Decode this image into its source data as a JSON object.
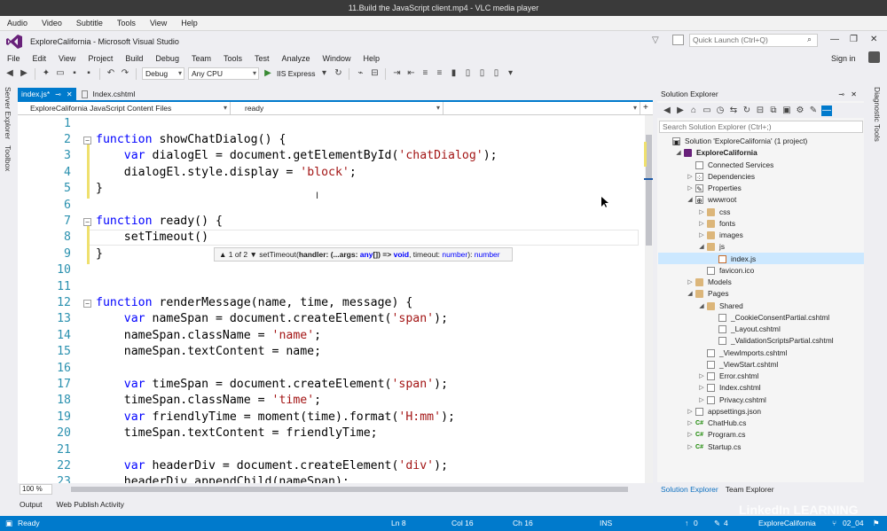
{
  "vlc": {
    "title": "11.Build the JavaScript client.mp4 - VLC media player",
    "menu": [
      "Audio",
      "Video",
      "Subtitle",
      "Tools",
      "View",
      "Help"
    ]
  },
  "vs": {
    "title": "ExploreCalifornia - Microsoft Visual Studio",
    "quick_launch_placeholder": "Quick Launch (Ctrl+Q)",
    "menu": [
      "File",
      "Edit",
      "View",
      "Project",
      "Build",
      "Debug",
      "Team",
      "Tools",
      "Test",
      "Analyze",
      "Window",
      "Help"
    ],
    "sign_in": "Sign in",
    "toolbar": {
      "config": "Debug",
      "platform": "Any CPU",
      "run_label": "IIS Express"
    }
  },
  "left_strip": [
    "Server Explorer",
    "Toolbox"
  ],
  "right_strip": [
    "Diagnostic Tools"
  ],
  "tabs": [
    {
      "label": "index.js*",
      "active": true
    },
    {
      "label": "Index.cshtml",
      "active": false
    }
  ],
  "nav_bar": {
    "project": "ExploreCalifornia JavaScript Content Files",
    "member": "ready",
    "third": ""
  },
  "code_lines": [
    {
      "n": "1",
      "t": ""
    },
    {
      "n": "2",
      "t": "function showChatDialog() {"
    },
    {
      "n": "3",
      "t": "    var dialogEl = document.getElementById('chatDialog');"
    },
    {
      "n": "4",
      "t": "    dialogEl.style.display = 'block';"
    },
    {
      "n": "5",
      "t": "}"
    },
    {
      "n": "6",
      "t": ""
    },
    {
      "n": "7",
      "t": "function ready() {"
    },
    {
      "n": "8",
      "t": "    setTimeout()"
    },
    {
      "n": "9",
      "t": "}"
    },
    {
      "n": "10",
      "t": ""
    },
    {
      "n": "11",
      "t": ""
    },
    {
      "n": "12",
      "t": "function renderMessage(name, time, message) {"
    },
    {
      "n": "13",
      "t": "    var nameSpan = document.createElement('span');"
    },
    {
      "n": "14",
      "t": "    nameSpan.className = 'name';"
    },
    {
      "n": "15",
      "t": "    nameSpan.textContent = name;"
    },
    {
      "n": "16",
      "t": ""
    },
    {
      "n": "17",
      "t": "    var timeSpan = document.createElement('span');"
    },
    {
      "n": "18",
      "t": "    timeSpan.className = 'time';"
    },
    {
      "n": "19",
      "t": "    var friendlyTime = moment(time).format('H:mm');"
    },
    {
      "n": "20",
      "t": "    timeSpan.textContent = friendlyTime;"
    },
    {
      "n": "21",
      "t": ""
    },
    {
      "n": "22",
      "t": "    var headerDiv = document.createElement('div');"
    },
    {
      "n": "23",
      "t": "    headerDiv.appendChild(nameSpan);"
    }
  ],
  "tooltip": {
    "counter": "1 of 2",
    "signature_prefix": "setTimeout(",
    "p1": "handler: (...args: ",
    "t1": "any",
    "p2": "[]) => ",
    "t2": "void",
    "p3": ", timeout: ",
    "t3": "number",
    "p4": "): ",
    "t4": "number"
  },
  "zoom": "100 %",
  "bottom_tabs": [
    "Output",
    "Web Publish Activity"
  ],
  "status": {
    "ready": "Ready",
    "ln": "Ln 8",
    "col": "Col 16",
    "ch": "Ch 16",
    "ins": "INS",
    "up": "0",
    "pencil": "4",
    "project": "ExploreCalifornia",
    "branch": "02_04"
  },
  "solution_explorer": {
    "title": "Solution Explorer",
    "search_placeholder": "Search Solution Explorer (Ctrl+;)",
    "items": [
      {
        "label": "Solution 'ExploreCalifornia' (1 project)",
        "icon": "solution",
        "tri": "",
        "depth": 0
      },
      {
        "label": "ExploreCalifornia",
        "icon": "project",
        "tri": "◢",
        "depth": 1,
        "bold": true
      },
      {
        "label": "Connected Services",
        "icon": "services",
        "tri": "",
        "depth": 2
      },
      {
        "label": "Dependencies",
        "icon": "deps",
        "tri": "▷",
        "depth": 2
      },
      {
        "label": "Properties",
        "icon": "wrench",
        "tri": "▷",
        "depth": 2
      },
      {
        "label": "wwwroot",
        "icon": "globe",
        "tri": "◢",
        "depth": 2
      },
      {
        "label": "css",
        "icon": "folder",
        "tri": "▷",
        "depth": 3
      },
      {
        "label": "fonts",
        "icon": "folder",
        "tri": "▷",
        "depth": 3
      },
      {
        "label": "images",
        "icon": "folder",
        "tri": "▷",
        "depth": 3
      },
      {
        "label": "js",
        "icon": "folder-open",
        "tri": "◢",
        "depth": 3
      },
      {
        "label": "index.js",
        "icon": "js",
        "tri": "",
        "depth": 4
      },
      {
        "label": "favicon.ico",
        "icon": "file",
        "tri": "",
        "depth": 3
      },
      {
        "label": "Models",
        "icon": "folder",
        "tri": "▷",
        "depth": 2
      },
      {
        "label": "Pages",
        "icon": "folder-open",
        "tri": "◢",
        "depth": 2
      },
      {
        "label": "Shared",
        "icon": "folder-open",
        "tri": "◢",
        "depth": 3
      },
      {
        "label": "_CookieConsentPartial.cshtml",
        "icon": "file",
        "tri": "",
        "depth": 4
      },
      {
        "label": "_Layout.cshtml",
        "icon": "file",
        "tri": "",
        "depth": 4
      },
      {
        "label": "_ValidationScriptsPartial.cshtml",
        "icon": "file",
        "tri": "",
        "depth": 4
      },
      {
        "label": "_ViewImports.cshtml",
        "icon": "file",
        "tri": "",
        "depth": 3
      },
      {
        "label": "_ViewStart.cshtml",
        "icon": "file",
        "tri": "",
        "depth": 3
      },
      {
        "label": "Error.cshtml",
        "icon": "file",
        "tri": "▷",
        "depth": 3
      },
      {
        "label": "Index.cshtml",
        "icon": "file",
        "tri": "▷",
        "depth": 3
      },
      {
        "label": "Privacy.cshtml",
        "icon": "file",
        "tri": "▷",
        "depth": 3
      },
      {
        "label": "appsettings.json",
        "icon": "file",
        "tri": "▷",
        "depth": 2
      },
      {
        "label": "ChatHub.cs",
        "icon": "cs",
        "tri": "▷",
        "depth": 2
      },
      {
        "label": "Program.cs",
        "icon": "cs",
        "tri": "▷",
        "depth": 2
      },
      {
        "label": "Startup.cs",
        "icon": "cs",
        "tri": "▷",
        "depth": 2
      }
    ],
    "bottom_tabs": [
      "Solution Explorer",
      "Team Explorer"
    ]
  },
  "watermark": "LinkedIn LEARNING",
  "colors": {
    "accent": "#007acc",
    "keyword": "#0000ff",
    "string": "#a31515",
    "line_number": "#2b91af"
  }
}
